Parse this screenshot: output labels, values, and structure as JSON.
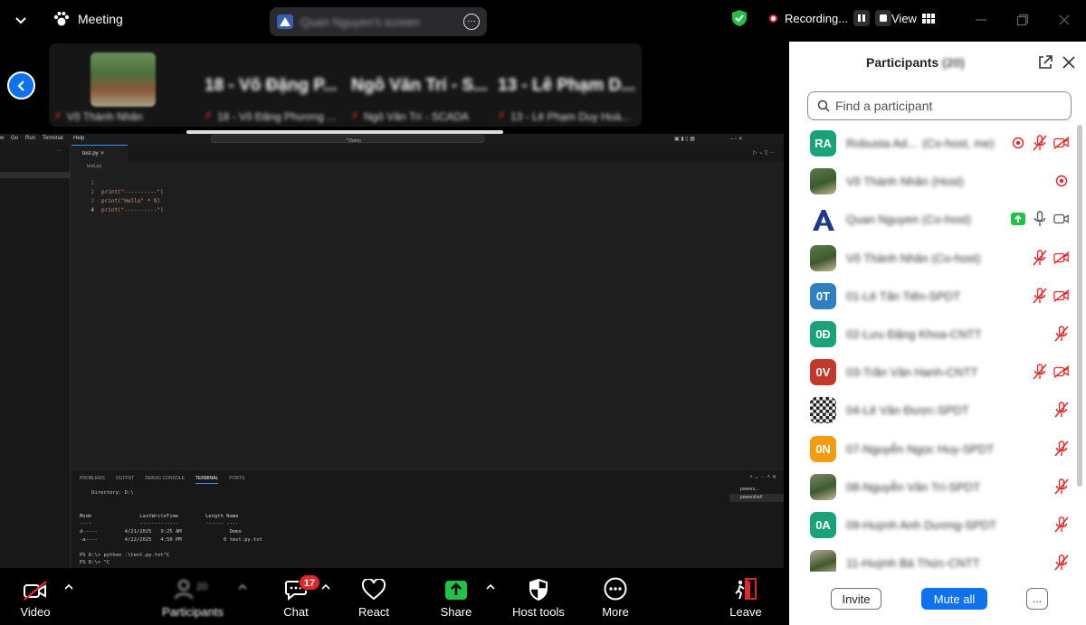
{
  "topbar": {
    "meeting_title": "Meeting",
    "shared_screen": "Quan Nguyen's screen",
    "recording_label": "Recording...",
    "view_label": "View"
  },
  "thumbnails": {
    "tiles": [
      {
        "name": "Võ Thành Nhân"
      },
      {
        "name": "18 - Võ Đặng Phương ...",
        "big": "18 - Võ Đặng P..."
      },
      {
        "name": "Ngô Văn Trí - SCADA",
        "big": "Ngô Văn Trí - S..."
      },
      {
        "name": "13 - Lê Phạm Duy Hoà...",
        "big": "13 - Lê Phạm D..."
      }
    ]
  },
  "vscode": {
    "menu": [
      "w",
      "Go",
      "Run",
      "Terminal",
      "Help"
    ],
    "search": "Demo",
    "tab": "test.py",
    "breadcrumb": "test.py",
    "code": [
      {
        "n": "1",
        "text": ""
      },
      {
        "n": "2",
        "text": "print(\"----------\")"
      },
      {
        "n": "3",
        "text": "print(\"Hello\" * 9)"
      },
      {
        "n": "4",
        "text": "print(\"----------\")"
      }
    ],
    "panel_tabs": [
      "PROBLEMS",
      "OUTPUT",
      "DEBUG CONSOLE",
      "TERMINAL",
      "PORTS"
    ],
    "active_panel_tab": "TERMINAL",
    "terminal_lines": [
      "    Directory: D:\\",
      "",
      "",
      "Mode                LastWriteTime         Length Name",
      "----                -------------         ------ ----",
      "d-----         4/21/2025   9:25 AM                Demo",
      "-a----         4/22/2025   4:50 PM              0 test.py.txt",
      "",
      "PS D:\\> python .\\test.py.txt^C",
      "PS D:\\> ^C"
    ],
    "terminal_list": [
      "powers...",
      "powershell"
    ]
  },
  "toolbar": {
    "video": "Video",
    "participants": "Participants",
    "participants_count": "20",
    "chat": "Chat",
    "chat_badge": "17",
    "react": "React",
    "share": "Share",
    "host_tools": "Host tools",
    "more": "More",
    "leave": "Leave"
  },
  "panel": {
    "title": "Participants",
    "count": "(20)",
    "search_placeholder": "Find a participant",
    "participants": [
      {
        "initials": "RA",
        "color": "#1aa37a",
        "name": "Robusta Ad...",
        "role": "(Co-host, me)",
        "icons": [
          "rec",
          "mic-off",
          "cam-off"
        ]
      },
      {
        "initials": "",
        "color": "#5a7d48",
        "photo": true,
        "name": "Võ Thành Nhân (Host)",
        "role": "",
        "icons": [
          "rec"
        ]
      },
      {
        "initials": "A",
        "color": "#ffffff",
        "logo": true,
        "name": "Quan Nguyen (Co-host)",
        "role": "",
        "icons": [
          "share",
          "mic",
          "cam"
        ]
      },
      {
        "initials": "",
        "color": "#5a7d48",
        "photo": true,
        "name": "Võ Thành Nhân (Co-host)",
        "role": "",
        "icons": [
          "mic-off",
          "cam-off"
        ]
      },
      {
        "initials": "0T",
        "color": "#2f7fc1",
        "name": "01-Lê Tấn Tiến-SPDT",
        "role": "",
        "icons": [
          "mic-off",
          "cam-off"
        ]
      },
      {
        "initials": "0Đ",
        "color": "#1aa37a",
        "name": "02-Lưu Đặng Khoa-CNTT",
        "role": "",
        "icons": [
          "mic-off"
        ]
      },
      {
        "initials": "0V",
        "color": "#c0392b",
        "name": "03-Trần Văn Hanh-CNTT",
        "role": "",
        "icons": [
          "mic-off",
          "cam-off"
        ]
      },
      {
        "initials": "",
        "color": "#444444",
        "qr": true,
        "name": "04-Lê Văn Được-SPDT",
        "role": "",
        "icons": [
          "mic-off"
        ]
      },
      {
        "initials": "0N",
        "color": "#f39c12",
        "name": "07-Nguyễn Ngọc Huy-SPDT",
        "role": "",
        "icons": [
          "mic-off"
        ]
      },
      {
        "initials": "",
        "color": "#7a8a6a",
        "photo": true,
        "name": "08-Nguyễn Văn Trí-SPDT",
        "role": "",
        "icons": [
          "mic-off"
        ]
      },
      {
        "initials": "0A",
        "color": "#1aa37a",
        "name": "09-Huỳnh Anh Dương-SPDT",
        "role": "",
        "icons": [
          "mic-off"
        ]
      },
      {
        "initials": "",
        "color": "#b8a898",
        "photo": true,
        "name": "11-Huỳnh Bá Thức-CNTT",
        "role": "",
        "icons": [
          "mic-off"
        ]
      }
    ],
    "invite": "Invite",
    "mute_all": "Mute all",
    "more": "..."
  },
  "colors": {
    "accent": "#0e72ed",
    "danger": "#e02828",
    "success": "#23c04a"
  }
}
